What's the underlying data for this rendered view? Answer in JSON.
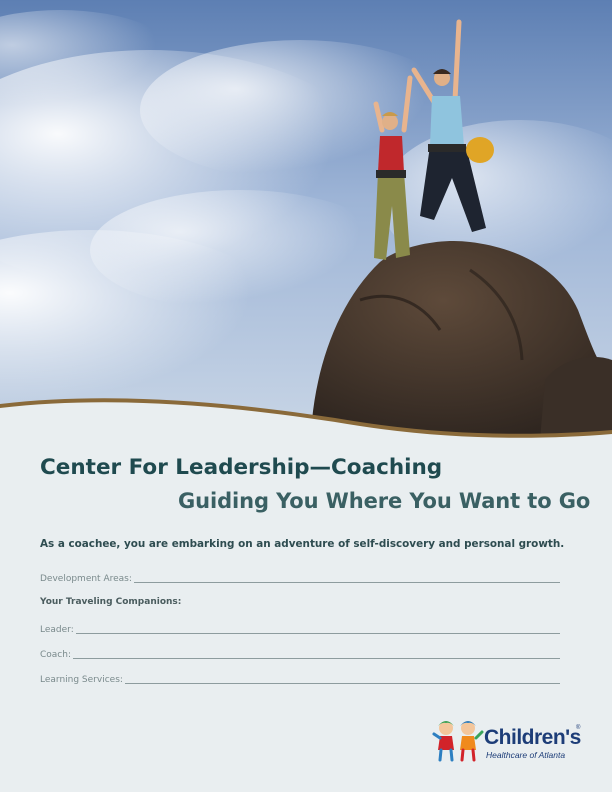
{
  "header": {
    "title": "Center For Leadership—Coaching",
    "subtitle": "Guiding You Where You Want to Go"
  },
  "intro_text": "As a coachee, you are embarking on an adventure of self-discovery and personal growth.",
  "form": {
    "development_areas_label": "Development Areas:",
    "companions_heading": "Your Traveling Companions:",
    "leader_label": "Leader:",
    "coach_label": "Coach:",
    "learning_services_label": "Learning Services:"
  },
  "logo": {
    "name": "Children's",
    "registered_mark": "®",
    "tagline": "Healthcare of Atlanta"
  },
  "colors": {
    "title": "#1f4a4f",
    "sky": "#7c9bc7",
    "panel": "#e9eef0",
    "accent_band": "#8a6a3a",
    "logo_blue": "#1d3d78"
  }
}
